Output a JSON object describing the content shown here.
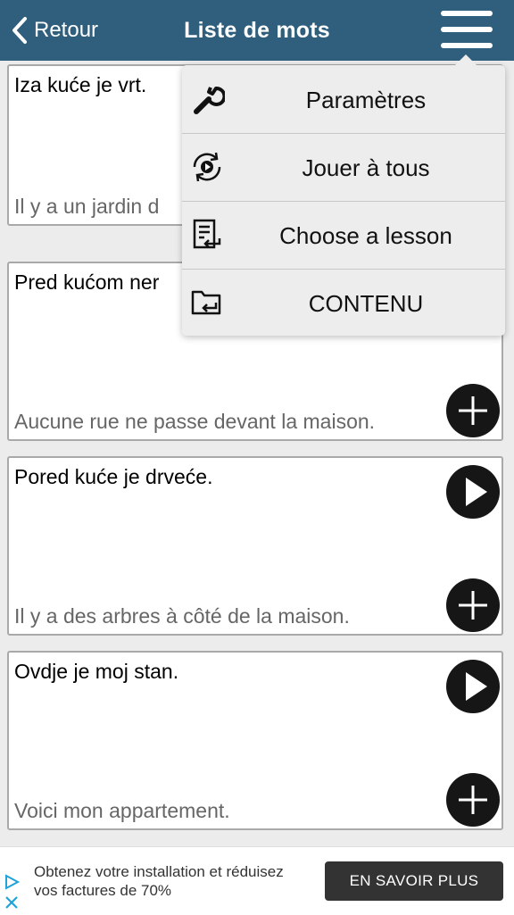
{
  "header": {
    "back_label": "Retour",
    "title": "Liste de mots"
  },
  "cards": [
    {
      "source": "Iza kuće je vrt.",
      "translation": "Il y a un jardin d"
    },
    {
      "source": "Pred kućom ner",
      "translation": "Aucune rue ne passe devant la maison."
    },
    {
      "source": "Pored kuće je drveće.",
      "translation": "Il y a des arbres à côté de la maison."
    },
    {
      "source": "Ovdje je moj stan.",
      "translation": "Voici mon appartement."
    }
  ],
  "menu": {
    "items": [
      {
        "label": "Paramètres",
        "icon": "wrench-icon"
      },
      {
        "label": "Jouer à tous",
        "icon": "play-all-icon"
      },
      {
        "label": "Choose a lesson",
        "icon": "lesson-icon"
      },
      {
        "label": "CONTENU",
        "icon": "folder-icon"
      }
    ]
  },
  "ad": {
    "text": "Obtenez votre installation et réduisez vos factures de 70%",
    "cta": "EN SAVOIR PLUS"
  },
  "colors": {
    "nav_bg": "#2f5f7d",
    "page_bg": "#ececec",
    "menu_bg": "#ededed",
    "button_dark": "#161616",
    "ad_choices": "#1fa3d8"
  }
}
